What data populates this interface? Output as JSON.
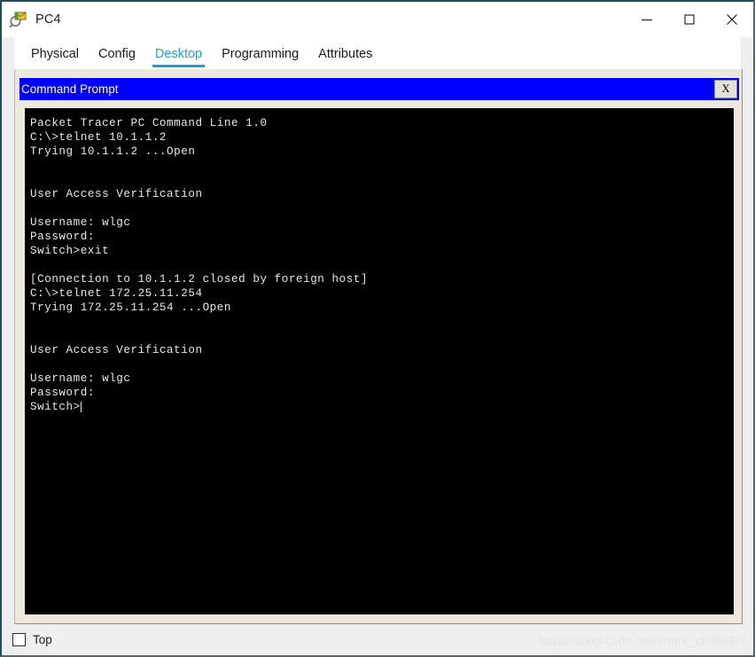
{
  "window": {
    "title": "PC4",
    "icon": "packet-tracer-magnifier-icon",
    "controls": {
      "minimize": "minimize-icon",
      "maximize": "maximize-icon",
      "close": "close-icon"
    }
  },
  "tabs": [
    {
      "label": "Physical",
      "active": false
    },
    {
      "label": "Config",
      "active": false
    },
    {
      "label": "Desktop",
      "active": true
    },
    {
      "label": "Programming",
      "active": false
    },
    {
      "label": "Attributes",
      "active": false
    }
  ],
  "command_prompt": {
    "title": "Command Prompt",
    "close_label": "X",
    "terminal_text": "Packet Tracer PC Command Line 1.0\nC:\\>telnet 10.1.1.2\nTrying 10.1.1.2 ...Open\n\n\nUser Access Verification\n\nUsername: wlgc\nPassword:\nSwitch>exit\n\n[Connection to 10.1.1.2 closed by foreign host]\nC:\\>telnet 172.25.11.254\nTrying 172.25.11.254 ...Open\n\n\nUser Access Verification\n\nUsername: wlgc\nPassword:\nSwitch>",
    "terminal_lines": [
      "Packet Tracer PC Command Line 1.0",
      "C:\\>telnet 10.1.1.2",
      "Trying 10.1.1.2 ...Open",
      "",
      "",
      "User Access Verification",
      "",
      "Username: wlgc",
      "Password:",
      "Switch>exit",
      "",
      "[Connection to 10.1.1.2 closed by foreign host]",
      "C:\\>telnet 172.25.11.254",
      "Trying 172.25.11.254 ...Open",
      "",
      "",
      "User Access Verification",
      "",
      "Username: wlgc",
      "Password:",
      "Switch>"
    ]
  },
  "bottom": {
    "top_checkbox_label": "Top",
    "top_checkbox_checked": false,
    "watermark": "https://blog.csdn.net/shark_chili3007"
  },
  "colors": {
    "title_bar_blue": "#0000ff",
    "tab_active": "#1e9fd8",
    "panel_beige": "#ece9dc",
    "terminal_bg": "#000000",
    "terminal_fg": "#e8e8e8",
    "window_border": "#1c4f5e"
  }
}
